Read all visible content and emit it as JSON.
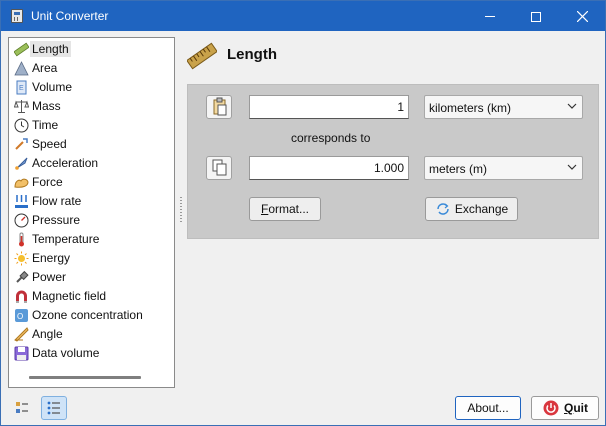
{
  "window": {
    "title": "Unit Converter",
    "controls": {
      "minimize": "minimize-icon",
      "maximize": "maximize-icon",
      "close": "close-icon"
    }
  },
  "sidebar": {
    "selected": "Length",
    "items": [
      {
        "label": "Length",
        "icon": "ruler-icon",
        "color": "#8ab04a"
      },
      {
        "label": "Area",
        "icon": "triangle-icon",
        "color": "#7d8fa8"
      },
      {
        "label": "Volume",
        "icon": "volume-icon",
        "color": "#4a7cc2"
      },
      {
        "label": "Mass",
        "icon": "scale-icon",
        "color": "#555555"
      },
      {
        "label": "Time",
        "icon": "clock-icon",
        "color": "#333333"
      },
      {
        "label": "Speed",
        "icon": "speed-icon",
        "color": "#d07a2a"
      },
      {
        "label": "Acceleration",
        "icon": "rocket-icon",
        "color": "#4a7cc2"
      },
      {
        "label": "Force",
        "icon": "arm-icon",
        "color": "#e7b04a"
      },
      {
        "label": "Flow rate",
        "icon": "flow-icon",
        "color": "#2a6fc9"
      },
      {
        "label": "Pressure",
        "icon": "gauge-icon",
        "color": "#333333"
      },
      {
        "label": "Temperature",
        "icon": "thermometer-icon",
        "color": "#d0322a"
      },
      {
        "label": "Energy",
        "icon": "sun-icon",
        "color": "#f0b420"
      },
      {
        "label": "Power",
        "icon": "plug-icon",
        "color": "#555555"
      },
      {
        "label": "Magnetic field",
        "icon": "magnet-icon",
        "color": "#c0303a"
      },
      {
        "label": "Ozone concentration",
        "icon": "ozone-icon",
        "color": "#5a9ad8"
      },
      {
        "label": "Angle",
        "icon": "protractor-icon",
        "color": "#e7b04a"
      },
      {
        "label": "Data volume",
        "icon": "floppy-icon",
        "color": "#6a4ac2"
      }
    ]
  },
  "header": {
    "title": "Length",
    "icon": "ruler-icon"
  },
  "converter": {
    "from": {
      "value": "1",
      "unit": "kilometers (km)",
      "paste_icon": "paste-icon"
    },
    "corresponds_label": "corresponds to",
    "to": {
      "value": "1.000",
      "unit": "meters (m)",
      "copy_icon": "copy-icon"
    },
    "format_label": "Format...",
    "exchange_label": "Exchange",
    "panel_color": "#c9c9c9"
  },
  "footer": {
    "view_buttons": [
      "tree-view-icon",
      "list-view-icon"
    ],
    "about_label": "About...",
    "quit_label": "Quit",
    "quit_icon_color": "#d9363e",
    "accent": "#1f64c0"
  }
}
